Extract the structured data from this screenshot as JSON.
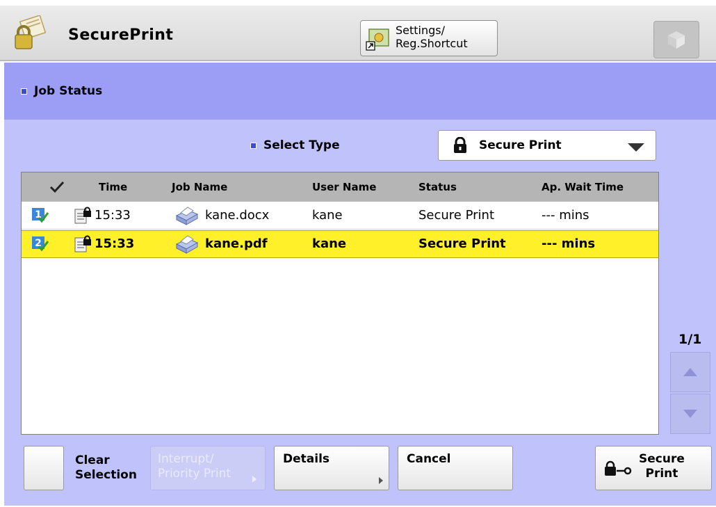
{
  "header": {
    "app_title": "SecurePrint",
    "app_icon": "lock-document-icon",
    "shortcut_button_label": "Settings/\nReg.Shortcut",
    "shortcut_icon": "settings-shortcut-icon",
    "top_right_icon": "cube-icon"
  },
  "job_status": {
    "label": "Job Status"
  },
  "select_type": {
    "label": "Select Type",
    "value": "Secure Print",
    "icon": "lock-icon"
  },
  "table": {
    "columns": [
      "Time",
      "Job Name",
      "User Name",
      "Status",
      "Ap. Wait Time"
    ],
    "rows": [
      {
        "index": "1",
        "time": "15:33",
        "job_name": "kane.docx",
        "user_name": "kane",
        "status": "Secure Print",
        "wait": "--- mins",
        "selected": false
      },
      {
        "index": "2",
        "time": "15:33",
        "job_name": "kane.pdf",
        "user_name": "kane",
        "status": "Secure Print",
        "wait": "--- mins",
        "selected": true
      }
    ]
  },
  "pager": {
    "indicator": "1/1"
  },
  "buttons": {
    "clear_selection": "Clear\nSelection",
    "interrupt_priority": "Interrupt/\nPriority Print",
    "details": "Details",
    "cancel": "Cancel",
    "secure_print": "Secure\nPrint"
  },
  "colors": {
    "band": "#9c9ef6",
    "content": "#c0c2fb",
    "highlight": "#fff02a"
  }
}
